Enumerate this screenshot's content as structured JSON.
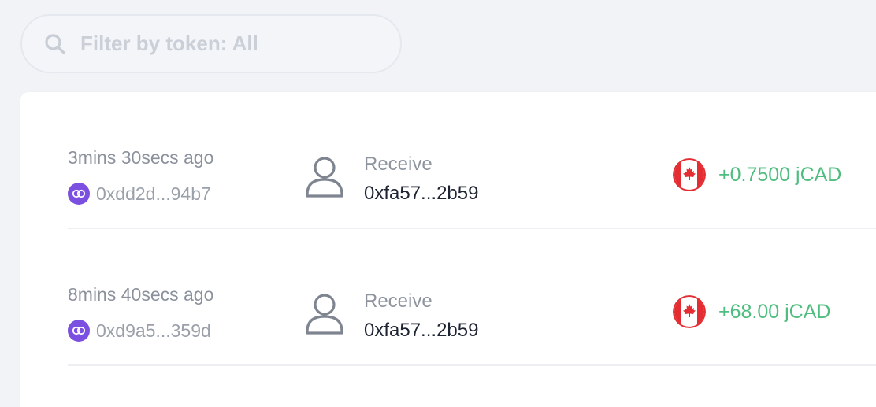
{
  "filter": {
    "placeholder": "Filter by token: All",
    "icon": "search-icon"
  },
  "transactions": [
    {
      "time": "3mins 30secs ago",
      "hash": "0xdd2d...94b7",
      "network_icon": "polygon-icon",
      "action": "Receive",
      "address": "0xfa57...2b59",
      "token_icon": "canada-flag-icon",
      "amount": "+0.7500 jCAD"
    },
    {
      "time": "8mins 40secs ago",
      "hash": "0xd9a5...359d",
      "network_icon": "polygon-icon",
      "action": "Receive",
      "address": "0xfa57...2b59",
      "token_icon": "canada-flag-icon",
      "amount": "+68.00 jCAD"
    }
  ],
  "colors": {
    "background": "#f1f3f7",
    "positive_amount": "#4fbd7f",
    "polygon": "#7b4fe0",
    "flag_red": "#e32d32"
  }
}
